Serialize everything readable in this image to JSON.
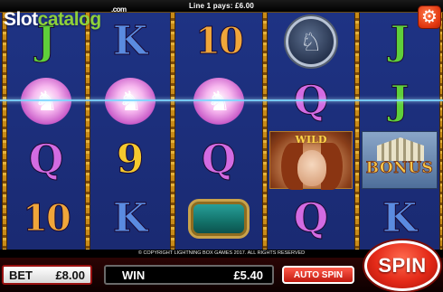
{
  "header": {
    "win_line_text": "Line 1 pays: £6.00"
  },
  "logo": {
    "part_a": "Slot",
    "part_b": "catalog",
    "dotcom": ".com"
  },
  "settings": {
    "icon": "gear-icon"
  },
  "reels": [
    [
      "J",
      "unicorn",
      "Q",
      "10"
    ],
    [
      "K",
      "unicorn",
      "9",
      "K"
    ],
    [
      "10",
      "unicorn",
      "Q",
      "bracelet"
    ],
    [
      "horse-medallion",
      "Q",
      "wild",
      "Q"
    ],
    [
      "J",
      "J",
      "bonus",
      "K"
    ]
  ],
  "symbols": {
    "wild_label": "WILD",
    "bonus_label": "BONUS"
  },
  "copyright": "© COPYRIGHT LIGHTNING BOX GAMES 2017. ALL RIGHTS RESERVED",
  "controls": {
    "bet_label": "BET",
    "bet_value": "£8.00",
    "win_label": "WIN",
    "win_value": "£5.40",
    "autospin_label": "AUTO SPIN",
    "spin_label": "SPIN"
  },
  "colors": {
    "background": "#1b2f7a",
    "frame_gold": "#c88b18",
    "spin_red": "#e42a18",
    "payline": "#7fd8ff"
  }
}
